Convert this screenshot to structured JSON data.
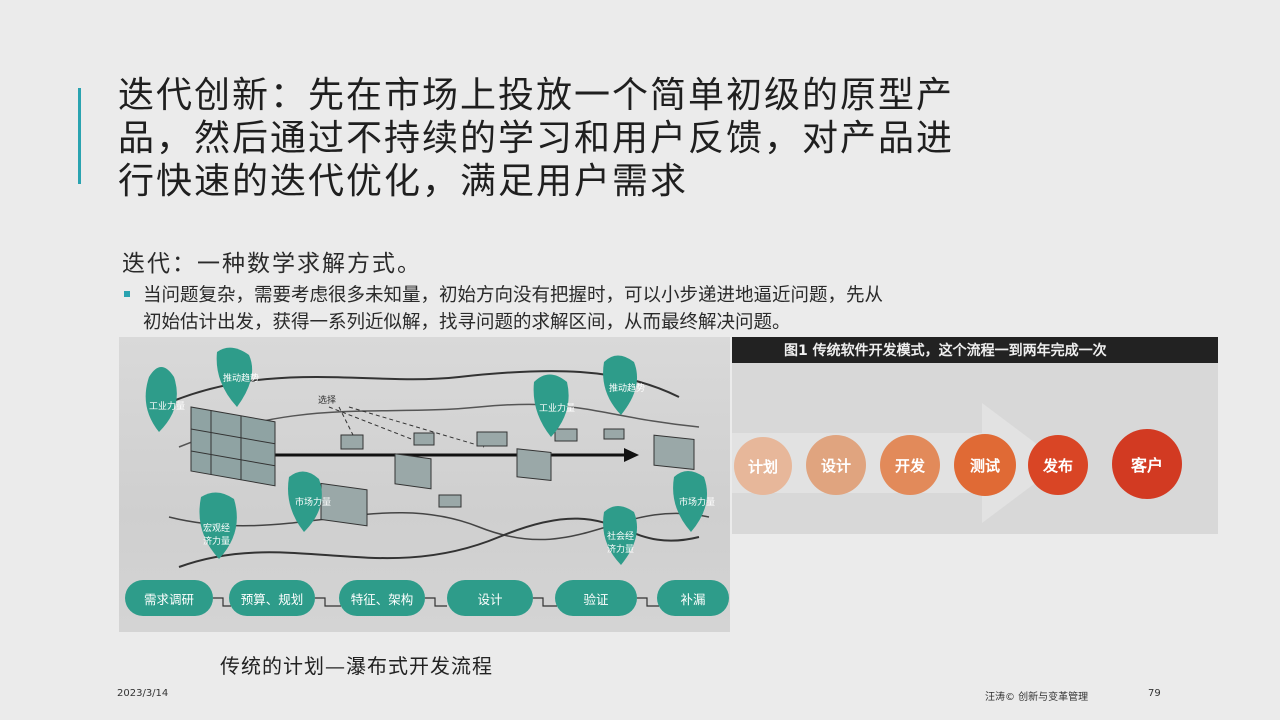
{
  "slide": {
    "title_lines": [
      "迭代创新：先在市场上投放一个简单初级的原型产",
      "品，然后通过不持续的学习和用户反馈，对产品进",
      "行快速的迭代优化，满足用户需求"
    ],
    "subtitle": "迭代：一种数学求解方式。",
    "bullet_lines": [
      "当问题复杂，需要考虑很多未知量，初始方向没有把握时，可以小步递进地逼近问题，先从",
      "初始估计出发，获得一系列近似解，找寻问题的求解区间，从而最终解决问题。"
    ],
    "caption": "传统的计划—瀑布式开发流程",
    "footer": {
      "date": "2023/3/14",
      "author": "汪涛© 创新与变革管理",
      "page": "79"
    }
  },
  "left_figure": {
    "select_label": "选择",
    "leaf_labels": [
      "工业力量",
      "推动趋势",
      "工业力量",
      "推动趋势",
      "市场力量",
      "宏观经济力量",
      "市场力量",
      "社会经济力量"
    ],
    "steps": [
      "需求调研",
      "预算、规划",
      "特征、架构",
      "设计",
      "验证",
      "补漏"
    ]
  },
  "right_figure": {
    "banner": "图1 传统软件开发模式，这个流程一到两年完成一次",
    "stages": [
      {
        "label": "计划",
        "color": "#e7b79a"
      },
      {
        "label": "设计",
        "color": "#e0a47f"
      },
      {
        "label": "开发",
        "color": "#e28a5a"
      },
      {
        "label": "测试",
        "color": "#e06a35"
      },
      {
        "label": "发布",
        "color": "#d94525"
      },
      {
        "label": "客户",
        "color": "#d23a22"
      }
    ]
  },
  "colors": {
    "accent": "#2aa3b0",
    "leaf_green": "#2e9c8a"
  }
}
